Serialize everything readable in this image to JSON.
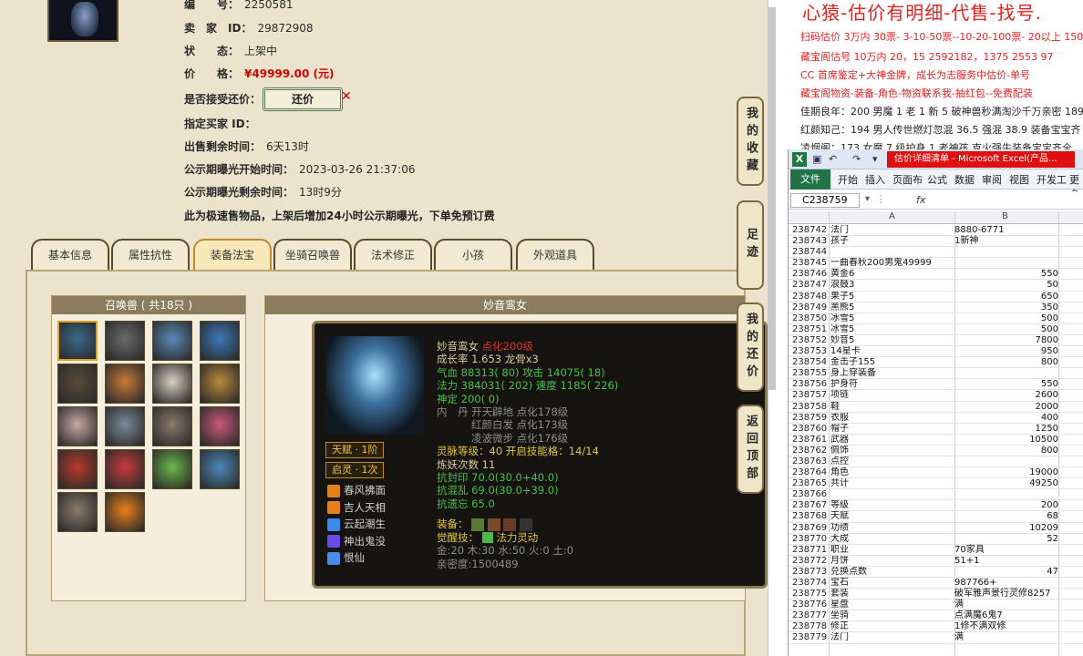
{
  "seller": {
    "number_label": "编　　号：",
    "number_value": "2250581",
    "id_label": "卖　家　ID：",
    "id_value": "29872908",
    "status_label": "状　　态：",
    "status_value": "上架中",
    "price_label": "价　　格：",
    "price_value": "¥49999.00 (元)",
    "counter_label": "是否接受还价：",
    "counter_button": "还价",
    "buyer_label": "指定买家 ID：",
    "remaining_label": "出售剩余时间：",
    "remaining_value": "6天13时",
    "public_start_label": "公示期曝光开始时间：",
    "public_start_value": "2023-03-26 21:37:06",
    "public_left_label": "公示期曝光剩余时间：",
    "public_left_value": "13时9分",
    "note": "此为极速售物品，上架后增加24小时公示期曝光，下单免预订费"
  },
  "tabs": [
    "基本信息",
    "属性抗性",
    "装备法宝",
    "坐骑召唤兽",
    "法术修正",
    "小孩",
    "外观道具"
  ],
  "active_tab": 2,
  "summons": {
    "header": "召唤兽 ( 共18只 )",
    "pet_colors": [
      "#3a6a8a",
      "#6a6a6a",
      "#5a8ab8",
      "#3a7ab8",
      "#5a4a3a",
      "#c87a3a",
      "#d8d0c0",
      "#b88a3a",
      "#c8a8a0",
      "#7a8a9a",
      "#8a7a6a",
      "#c85a7a",
      "#b83a2a",
      "#c83a3a",
      "#6ab84a",
      "#4a8ab8",
      "#8a7a6a",
      "#e8801a"
    ]
  },
  "detail": {
    "header": "妙音鸾女",
    "name": "妙音鸾女",
    "name_extra": "点化200级",
    "growth": "成长率 1.653  龙骨x3",
    "hp": "气血 88313( 80)",
    "atk": "攻击 14075( 18)",
    "mp": "法力 384031( 202)",
    "spd": "速度 1185( 226)",
    "def": "神定 200( 0)",
    "dan1": "内　丹 开天辟地 点化178级",
    "dan2": "红颜白发 点化173级",
    "dan3": "凌波微步 点化176级",
    "spirit": "灵脉等级：40 开启技能格：14/14",
    "demon": "炼妖次数 11",
    "res1": "抗封印 70.0(30.0+40.0)",
    "res2": "抗混乱 69.0(30.0+39.0)",
    "res3": "抗遗忘 65.0",
    "equip_label": "装备：",
    "awaken_label": "觉醒技：",
    "awaken_skill": "法力灵动",
    "elements": "金:20 木:30 水:50 火:0 土:0",
    "intimacy": "亲密度:1500489",
    "tag1": "天赋 · 1阶",
    "tag2": "启灵 · 1次",
    "skills": [
      "春风拂面",
      "吉人天相",
      "云起潮生",
      "神出鬼没",
      "恨仙"
    ],
    "skill_colors": [
      "#e8801a",
      "#e8801a",
      "#3a8ae8",
      "#6a4ae8",
      "#4a8ae8"
    ]
  },
  "side": {
    "favorite": "我的收藏",
    "footprint": "足迹",
    "my_offer": "我的还价",
    "top": "返回顶部"
  },
  "notes": {
    "headline": "心猿-估价有明细-代售-找号.",
    "line1": "扫码估价 3万内 30票- 3-10-50票--10-20-100票- 20以上 150",
    "line2": "藏宝阁估号 10万内 20，15 2592182，1375 2553 97",
    "line3": "CC 首席鉴定+大神金牌，成长为志服务中估价-单号",
    "line4": "藏宝阁物资-装备-角色-物资联系我-抽红包--免费配装",
    "line5": "佳期良年：200 男魔 1 老 1 新 5 破神兽秒满淘沙千万亲密 189",
    "line6": "红颜知己：194 男人传世燃灯忽混 36.5 强混 38.9 装备宝宝齐",
    "line7": "凌烟阁：173 女魔 7 级护身 1 老神孩 克火强牛装备宝宝齐全"
  },
  "excel": {
    "title": "估价详细清单 - Microsoft Excel(产品...",
    "ribbon": [
      "文件",
      "开始",
      "插入",
      "页面布",
      "公式",
      "数据",
      "审阅",
      "视图",
      "开发工",
      "更多"
    ],
    "name_box": "C238759",
    "fx": "fx",
    "col_a": "A",
    "col_b": "B",
    "rows": [
      [
        "238742",
        "法门",
        "8880-6771",
        false
      ],
      [
        "238743",
        "孩子",
        "1新神",
        false
      ],
      [
        "238744",
        "",
        "",
        false
      ],
      [
        "238745",
        "一曲春秋200男鬼49999",
        "",
        false
      ],
      [
        "238746",
        "黄金6",
        "550",
        true
      ],
      [
        "238747",
        "浪鼓3",
        "50",
        true
      ],
      [
        "238748",
        "果子5",
        "650",
        true
      ],
      [
        "238749",
        "黑熊5",
        "350",
        true
      ],
      [
        "238750",
        "冰雪5",
        "500",
        true
      ],
      [
        "238751",
        "冰雪5",
        "500",
        true
      ],
      [
        "238752",
        "妙音5",
        "7800",
        true
      ],
      [
        "238753",
        "14星卡",
        "950",
        true
      ],
      [
        "238754",
        "金击子155",
        "800",
        true
      ],
      [
        "238755",
        "身上穿装备",
        "",
        false
      ],
      [
        "238756",
        "护身符",
        "550",
        true
      ],
      [
        "238757",
        "项链",
        "2600",
        true
      ],
      [
        "238758",
        "鞋",
        "2000",
        true
      ],
      [
        "238759",
        "衣服",
        "400",
        true
      ],
      [
        "238760",
        "帽子",
        "1250",
        true
      ],
      [
        "238761",
        "武器",
        "10500",
        true
      ],
      [
        "238762",
        "佩饰",
        "800",
        true
      ],
      [
        "238763",
        "点控",
        "",
        false
      ],
      [
        "238764",
        "角色",
        "19000",
        true
      ],
      [
        "238765",
        "共计",
        "49250",
        true
      ],
      [
        "238766",
        "",
        "",
        false
      ],
      [
        "238767",
        "等级",
        "200",
        true
      ],
      [
        "238768",
        "天赋",
        "68",
        true
      ],
      [
        "238769",
        "功绩",
        "10209",
        true
      ],
      [
        "238770",
        "大成",
        "52",
        true
      ],
      [
        "238771",
        "职业",
        "70家具",
        false
      ],
      [
        "238772",
        "月饼",
        "51+1",
        false
      ],
      [
        "238773",
        "兑换点数",
        "47",
        true
      ],
      [
        "238774",
        "宝石",
        "987766+",
        false
      ],
      [
        "238775",
        "套装",
        "破军雅声景行灵修8257",
        false
      ],
      [
        "238776",
        "星盘",
        "满",
        false
      ],
      [
        "238777",
        "坐骑",
        "点满魔6鬼7",
        false
      ],
      [
        "238778",
        "修正",
        "1修不满双修",
        false
      ],
      [
        "238779",
        "法门",
        "满",
        false
      ]
    ]
  }
}
